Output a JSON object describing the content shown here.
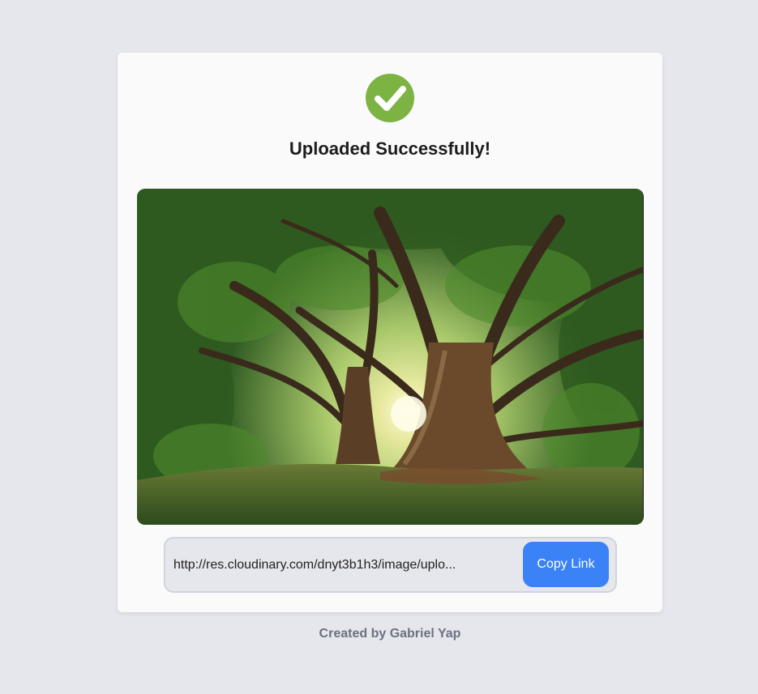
{
  "status": {
    "icon": "check-circle-icon",
    "title": "Uploaded Successfully!",
    "accent": "#7cb342"
  },
  "image": {
    "description_icon": "uploaded-tree-photo"
  },
  "link": {
    "url": "http://res.cloudinary.com/dnyt3b1h3/image/uplo...",
    "copy_label": "Copy Link",
    "button_color": "#3b82f6"
  },
  "footer": {
    "credit": "Created by Gabriel Yap"
  }
}
